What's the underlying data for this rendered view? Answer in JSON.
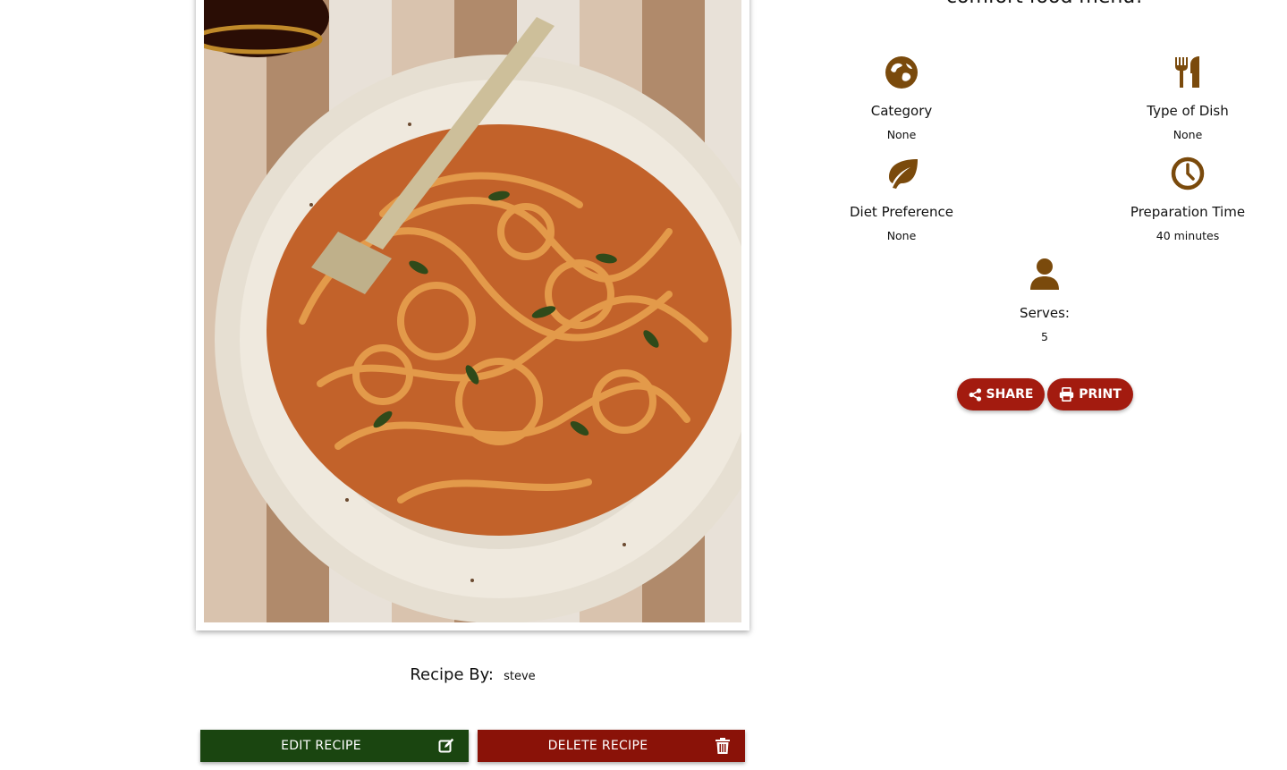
{
  "intro": {
    "text": "comfort food menu!"
  },
  "recipe_image": {
    "alt": "Spaghetti bolognese with herbs on a white plate"
  },
  "recipe_by": {
    "label": "Recipe By:",
    "value": "steve"
  },
  "actions": {
    "edit_label": "EDIT RECIPE",
    "delete_label": "DELETE RECIPE"
  },
  "details": {
    "category": {
      "label": "Category",
      "value": "None",
      "icon": "globe-icon"
    },
    "type_of_dish": {
      "label": "Type of Dish",
      "value": "None",
      "icon": "utensils-icon"
    },
    "diet_preference": {
      "label": "Diet Preference",
      "value": "None",
      "icon": "leaf-icon"
    },
    "preparation_time": {
      "label": "Preparation Time",
      "value": "40 minutes",
      "icon": "clock-icon"
    },
    "serves": {
      "label": "Serves:",
      "value": "5",
      "icon": "user-icon"
    }
  },
  "share": {
    "share_label": "SHARE",
    "print_label": "PRINT"
  },
  "colors": {
    "icon_brown": "#7a4a0c",
    "edit_green": "#1a4510",
    "delete_red": "#8a1208",
    "pill_red": "#a31b0f"
  }
}
